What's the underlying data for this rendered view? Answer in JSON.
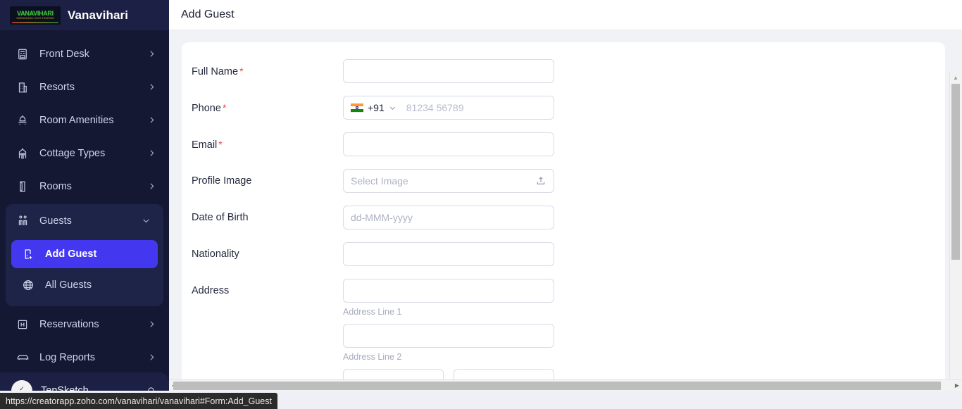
{
  "brand": {
    "logo_text": "VANAVIHARI",
    "logo_sub": "MARADUMILLI ECO TOURISM",
    "name": "Vanavihari"
  },
  "sidebar": {
    "items": [
      {
        "label": "Front Desk",
        "icon": "front-desk-icon",
        "expandable": true
      },
      {
        "label": "Resorts",
        "icon": "resort-building-icon",
        "expandable": true
      },
      {
        "label": "Room Amenities",
        "icon": "amenities-icon",
        "expandable": true
      },
      {
        "label": "Cottage Types",
        "icon": "cottage-icon",
        "expandable": true
      },
      {
        "label": "Rooms",
        "icon": "room-door-icon",
        "expandable": true
      },
      {
        "label": "Guests",
        "icon": "guests-icon",
        "expandable": true,
        "expanded": true
      },
      {
        "label": "Reservations",
        "icon": "reservation-icon",
        "expandable": true
      },
      {
        "label": "Log Reports",
        "icon": "vehicle-icon",
        "expandable": true
      }
    ],
    "guests_children": [
      {
        "label": "Add Guest",
        "icon": "add-guest-icon",
        "active": true
      },
      {
        "label": "All Guests",
        "icon": "globe-icon",
        "active": false
      }
    ],
    "active_color": "#4338f0",
    "background": "#151833",
    "group_background": "#1e2348"
  },
  "user": {
    "name": "TenSketch",
    "avatar_mark": "✓",
    "avatar_label": "TenSketch",
    "notification_icon": "bell-icon"
  },
  "header": {
    "title": "Add Guest"
  },
  "form": {
    "fields": [
      {
        "label": "Full Name",
        "required": true,
        "type": "text",
        "value": "",
        "placeholder": ""
      },
      {
        "label": "Phone",
        "required": true,
        "type": "phone",
        "country_code": "+91",
        "flag": "india-flag",
        "value": "",
        "placeholder": "81234 56789"
      },
      {
        "label": "Email",
        "required": true,
        "type": "text",
        "value": "",
        "placeholder": ""
      },
      {
        "label": "Profile Image",
        "required": false,
        "type": "file",
        "value": "",
        "placeholder": "Select Image",
        "icon": "upload-icon"
      },
      {
        "label": "Date of Birth",
        "required": false,
        "type": "date",
        "value": "",
        "placeholder": "dd-MMM-yyyy"
      },
      {
        "label": "Nationality",
        "required": false,
        "type": "text",
        "value": "",
        "placeholder": ""
      },
      {
        "label": "Address",
        "required": false,
        "type": "address",
        "value": "",
        "placeholder": ""
      }
    ],
    "address_hints": [
      "Address Line 1",
      "Address Line 2"
    ],
    "required_marker": "*"
  },
  "status_bar": {
    "url": "https://creatorapp.zoho.com/vanavihari/vanavihari#Form:Add_Guest"
  },
  "scrollbars": {
    "vertical_present": true,
    "horizontal_present": true
  }
}
